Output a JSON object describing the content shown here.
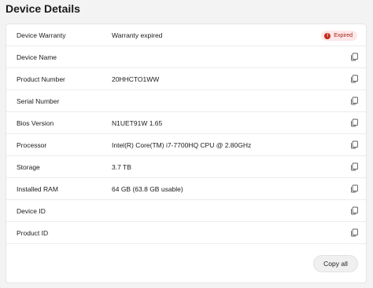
{
  "section": {
    "title": "Device Details"
  },
  "rows": [
    {
      "label": "Device Warranty",
      "value": "Warranty expired",
      "badge": "Expired",
      "badge_icon": "!"
    },
    {
      "label": "Device Name",
      "value": ""
    },
    {
      "label": "Product Number",
      "value": "20HHCTO1WW"
    },
    {
      "label": "Serial Number",
      "value": ""
    },
    {
      "label": "Bios Version",
      "value": "N1UET91W 1.65"
    },
    {
      "label": "Processor",
      "value": "Intel(R) Core(TM) i7-7700HQ CPU @ 2.80GHz"
    },
    {
      "label": "Storage",
      "value": "3.7 TB"
    },
    {
      "label": "Installed RAM",
      "value": "64 GB (63.8 GB usable)"
    },
    {
      "label": "Device ID",
      "value": ""
    },
    {
      "label": "Product ID",
      "value": ""
    }
  ],
  "actions": {
    "copy_all_label": "Copy all"
  },
  "icons": {
    "copy": "copy-icon",
    "warning": "error-circle-icon"
  },
  "colors": {
    "badge_background": "#fde7e9",
    "badge_icon": "#c42b1c",
    "badge_text": "#9f1e12"
  }
}
